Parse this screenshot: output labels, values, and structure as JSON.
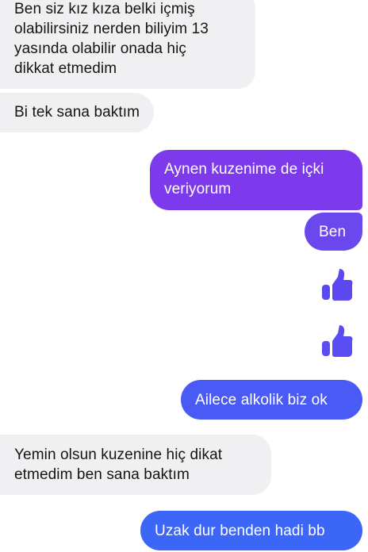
{
  "messages": [
    {
      "side": "incoming",
      "text": "Ben siz kız kıza belki içmiş\nolabilirsiniz nerden biliyim 13\nyasında olabilir onada hiç\ndikkat etmedim"
    },
    {
      "side": "incoming",
      "text": "Bi tek sana baktım"
    },
    {
      "side": "outgoing",
      "text": "Aynen kuzenime de içki\nveriyorum"
    },
    {
      "side": "outgoing",
      "text": "Ben"
    },
    {
      "side": "outgoing",
      "type": "like",
      "icon": "thumbs-up-icon"
    },
    {
      "side": "outgoing",
      "type": "like",
      "icon": "thumbs-up-icon"
    },
    {
      "side": "outgoing",
      "text": "Ailece alkolik biz ok"
    },
    {
      "side": "incoming",
      "text": "Yemin olsun kuzenine hiç dikat\netmedim ben sana baktım"
    },
    {
      "side": "outgoing",
      "text": "Uzak dur benden hadi bb"
    }
  ],
  "colors": {
    "incoming_bg": "#f0f0f2",
    "outgoing_purple": "#8a2be2",
    "outgoing_violet": "#6a45ee",
    "outgoing_blue": "#4a5cf5",
    "outgoing_blue2": "#3866f5",
    "like_icon": "#6743f0"
  }
}
